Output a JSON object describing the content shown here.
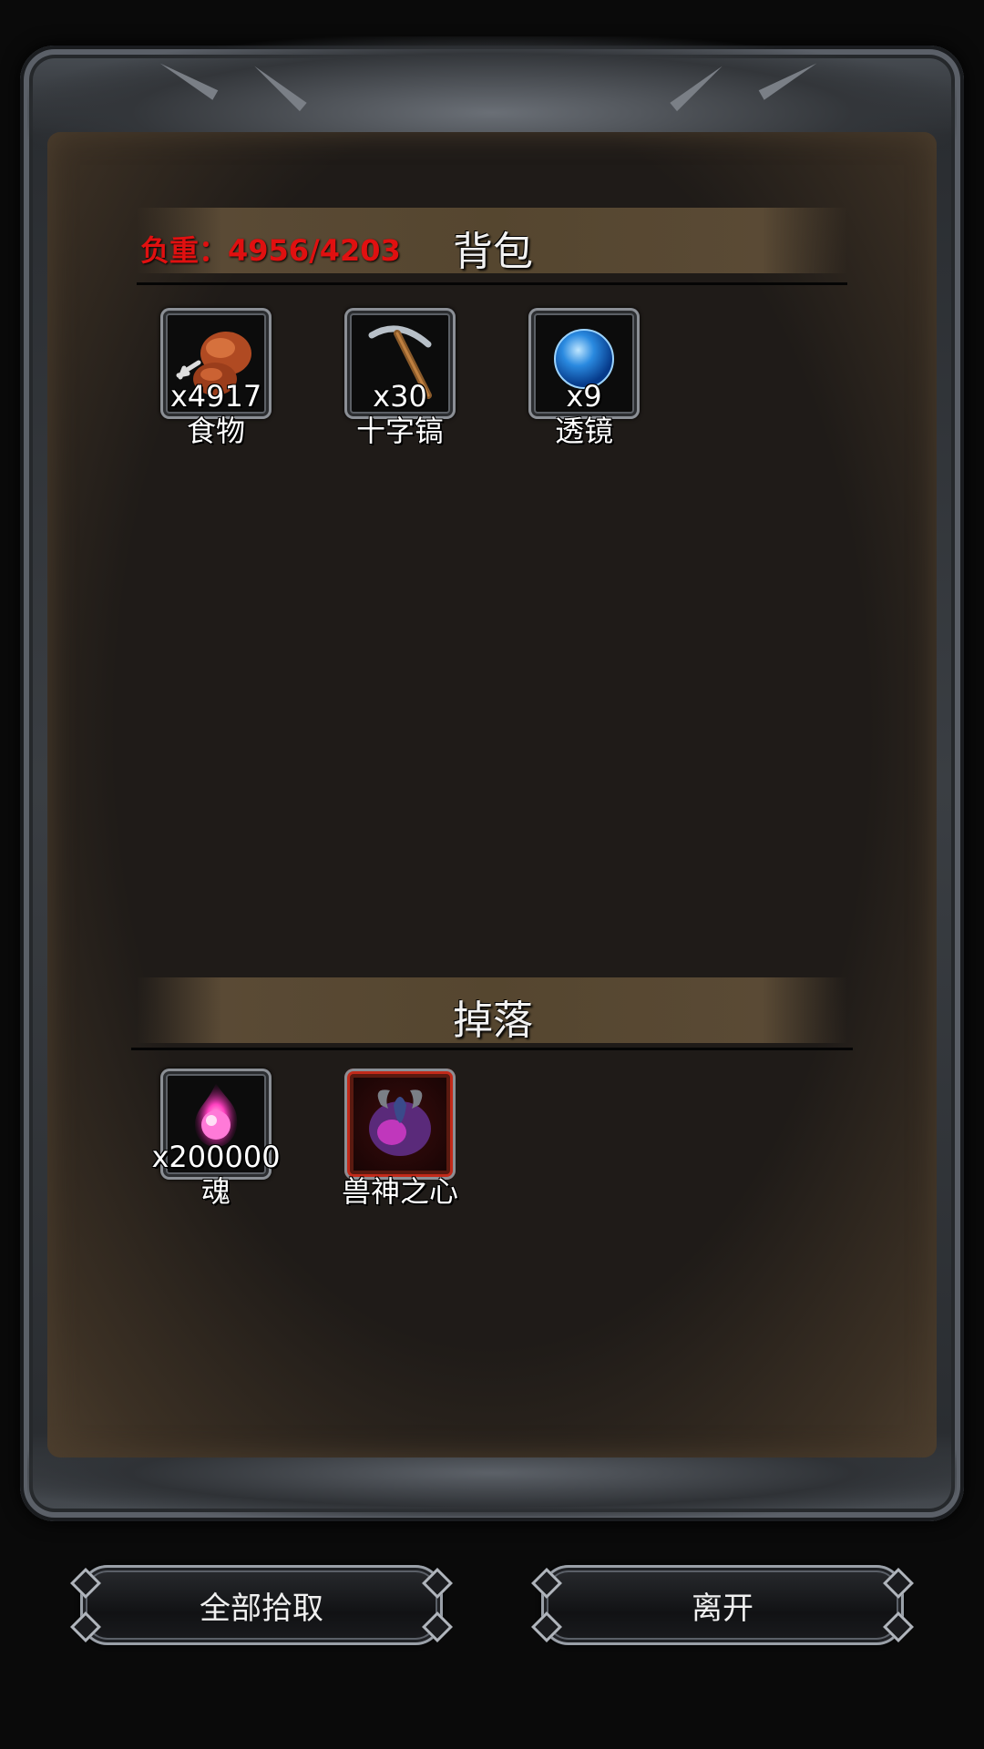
{
  "backpack": {
    "title": "背包",
    "weight_label": "负重：4956/4203",
    "items": [
      {
        "name": "食物",
        "qty": "x4917",
        "icon": "meat-icon"
      },
      {
        "name": "十字镐",
        "qty": "x30",
        "icon": "pickaxe-icon"
      },
      {
        "name": "透镜",
        "qty": "x9",
        "icon": "lens-orb-icon"
      }
    ]
  },
  "drops": {
    "title": "掉落",
    "items": [
      {
        "name": "魂",
        "qty": "x200000",
        "icon": "soul-flame-icon"
      },
      {
        "name": "兽神之心",
        "qty": "",
        "icon": "beast-heart-icon",
        "rarity_color": "#c22a1a"
      }
    ]
  },
  "buttons": {
    "pickup_all": "全部拾取",
    "leave": "离开"
  },
  "colors": {
    "weight_text": "#e01010",
    "header_bar": "#55462f",
    "panel_bg": "#1f1b18"
  }
}
